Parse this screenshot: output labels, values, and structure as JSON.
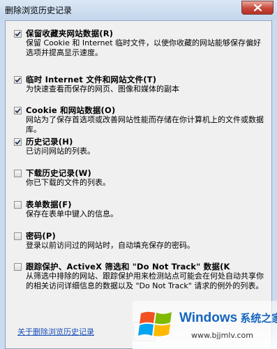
{
  "window": {
    "title": "删除浏览历史记录"
  },
  "items": [
    {
      "label": "保留收藏夹网站数据(R)",
      "checked": true,
      "desc": "保留 Cookie 和 Internet 临时文件，以使你收藏的网站能够保存偏好选项并提高显示速度。"
    },
    {
      "label": "临时 Internet 文件和网站文件(T)",
      "checked": true,
      "desc": "为快速查看而保存的网页、图像和媒体的副本"
    },
    {
      "label": "Cookie 和网站数据(O)",
      "checked": true,
      "desc": "网站为了保存首选项或改善网站性能而存储在你计算机上的文件或数据库。"
    },
    {
      "label": "历史记录(H)",
      "checked": true,
      "desc": "已访问网站的列表。"
    },
    {
      "label": "下载历史记录(W)",
      "checked": false,
      "desc": "你已下载的文件的列表。"
    },
    {
      "label": "表单数据(F)",
      "checked": false,
      "desc": "保存在表单中键入的信息。"
    },
    {
      "label": "密码(P)",
      "checked": false,
      "desc": "登录以前访问过的网站时，自动填充保存的密码。"
    },
    {
      "label": "跟踪保护、ActiveX 筛选和 \"Do Not Track\" 数据(K",
      "checked": false,
      "desc": "从筛选中排除的网站、跟踪保护用来检测站点可能会在何处自动共享你的相关访问详细信息的数据以及 \"Do Not Track\" 请求的例外的列表。"
    }
  ],
  "footer": {
    "link": "关于删除浏览历史记录"
  },
  "watermark": {
    "brand": "Windows",
    "brand_cn": "系统之家",
    "url": "www.bjjmlv.com"
  }
}
